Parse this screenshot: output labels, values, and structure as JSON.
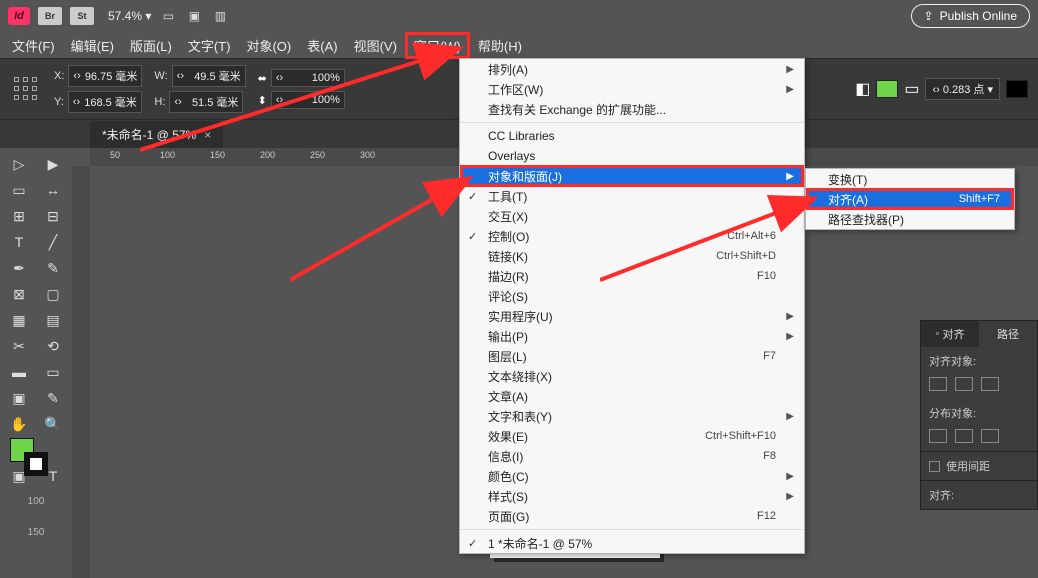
{
  "appbar": {
    "br": "Br",
    "st": "St",
    "zoom": "57.4%",
    "publish": "Publish Online"
  },
  "menubar": {
    "file": "文件(F)",
    "edit": "编辑(E)",
    "layout": "版面(L)",
    "type": "文字(T)",
    "object": "对象(O)",
    "table": "表(A)",
    "view": "视图(V)",
    "window": "窗口(W)",
    "help": "帮助(H)"
  },
  "ctrl": {
    "x_label": "X:",
    "x": "96.75 毫米",
    "y_label": "Y:",
    "y": "168.5 毫米",
    "w_label": "W:",
    "w": "49.5 毫米",
    "h_label": "H:",
    "h": "51.5 毫米",
    "pct1": "100%",
    "pct2": "100%",
    "stroke": "0.283 点"
  },
  "tab": {
    "title": "*未命名-1 @ 57%"
  },
  "ruler": {
    "t50": "50",
    "t100": "100",
    "t150": "150",
    "t200": "200",
    "t250": "250",
    "t300": "300",
    "v100": "100",
    "v150": "150"
  },
  "dropdown": {
    "arrange": "排列(A)",
    "workspace": "工作区(W)",
    "exchange": "查找有关 Exchange 的扩展功能...",
    "cc": "CC Libraries",
    "overlays": "Overlays",
    "objlayout": "对象和版面(J)",
    "tools": "工具(T)",
    "interactive": "交互(X)",
    "control": "控制(O)",
    "control_sc": "Ctrl+Alt+6",
    "links": "链接(K)",
    "links_sc": "Ctrl+Shift+D",
    "stroke": "描边(R)",
    "stroke_sc": "F10",
    "review": "评论(S)",
    "utilities": "实用程序(U)",
    "output": "输出(P)",
    "layers": "图层(L)",
    "layers_sc": "F7",
    "textwrap": "文本绕排(X)",
    "article": "文章(A)",
    "typeandtable": "文字和表(Y)",
    "effects": "效果(E)",
    "effects_sc": "Ctrl+Shift+F10",
    "info": "信息(I)",
    "info_sc": "F8",
    "color": "颜色(C)",
    "styles": "样式(S)",
    "pages": "页面(G)",
    "pages_sc": "F12",
    "doc1": "1 *未命名-1 @ 57%"
  },
  "submenu": {
    "transform": "变换(T)",
    "align": "对齐(A)",
    "align_sc": "Shift+F7",
    "pathfinder": "路径查找器(P)"
  },
  "alignpanel": {
    "tab1": "对齐",
    "tab2": "路径",
    "sect1": "对齐对象:",
    "sect2": "分布对象:",
    "spacing": "使用间距",
    "footer": "对齐:"
  }
}
